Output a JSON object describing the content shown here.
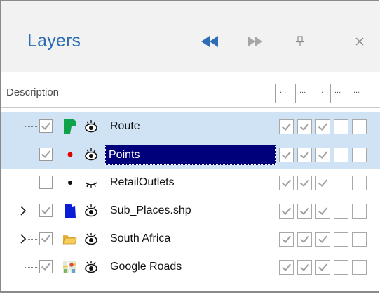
{
  "panel": {
    "title": "Layers",
    "buttons": {
      "back_icon": "double-left-arrow-icon",
      "forward_icon": "double-right-arrow-icon",
      "pin_icon": "pin-icon",
      "close_icon": "close-icon"
    },
    "accent_color": "#2d6db5"
  },
  "grid": {
    "columns": [
      "Description",
      "...",
      "...",
      "...",
      "...",
      "..."
    ],
    "selection_color": "#00007a",
    "highlight_color": "#cfe3f5",
    "layers": [
      {
        "name": "Route",
        "checked": true,
        "icon": "route-polygon-icon",
        "visibility_icon": "eye-open-icon",
        "highlighted": true,
        "selected": false,
        "expandable": false,
        "cells": [
          true,
          true,
          true,
          false,
          false
        ]
      },
      {
        "name": "Points",
        "checked": true,
        "icon": "point-symbol-icon",
        "visibility_icon": "eye-open-icon",
        "highlighted": true,
        "selected": true,
        "expandable": false,
        "cells": [
          true,
          true,
          true,
          false,
          false
        ]
      },
      {
        "name": "RetailOutlets",
        "checked": false,
        "icon": "point-symbol-icon",
        "visibility_icon": "eye-closed-icon",
        "highlighted": false,
        "selected": false,
        "expandable": false,
        "cells": [
          true,
          true,
          true,
          false,
          false
        ]
      },
      {
        "name": "Sub_Places.shp",
        "checked": true,
        "icon": "polygon-layer-icon",
        "visibility_icon": "eye-open-icon",
        "highlighted": false,
        "selected": false,
        "expandable": true,
        "cells": [
          true,
          true,
          true,
          false,
          false
        ]
      },
      {
        "name": "South Africa",
        "checked": true,
        "icon": "folder-icon",
        "visibility_icon": "eye-open-icon",
        "highlighted": false,
        "selected": false,
        "expandable": true,
        "cells": [
          true,
          true,
          true,
          false,
          false
        ]
      },
      {
        "name": "Google Roads",
        "checked": true,
        "icon": "map-tiles-icon",
        "visibility_icon": "eye-open-icon",
        "highlighted": false,
        "selected": false,
        "expandable": false,
        "cells": [
          true,
          true,
          true,
          false,
          false
        ]
      }
    ]
  }
}
